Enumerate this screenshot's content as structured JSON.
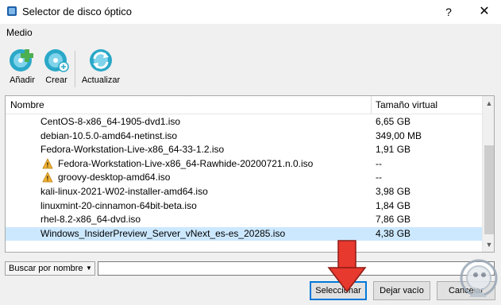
{
  "window": {
    "title": "Selector de disco óptico",
    "help_glyph": "?",
    "close_glyph": "✕"
  },
  "menu": {
    "medio": "Medio"
  },
  "toolbar": {
    "add_label": "Añadir",
    "create_label": "Crear",
    "refresh_label": "Actualizar"
  },
  "list": {
    "columns": {
      "name": "Nombre",
      "size": "Tamaño virtual"
    },
    "sort_glyph": "⌃",
    "rows": [
      {
        "name": "CentOS-8-x86_64-1905-dvd1.iso",
        "size": "6,65 GB",
        "warning": false,
        "selected": false
      },
      {
        "name": "debian-10.5.0-amd64-netinst.iso",
        "size": "349,00 MB",
        "warning": false,
        "selected": false
      },
      {
        "name": "Fedora-Workstation-Live-x86_64-33-1.2.iso",
        "size": "1,91 GB",
        "warning": false,
        "selected": false
      },
      {
        "name": "Fedora-Workstation-Live-x86_64-Rawhide-20200721.n.0.iso",
        "size": "--",
        "warning": true,
        "selected": false
      },
      {
        "name": "groovy-desktop-amd64.iso",
        "size": "--",
        "warning": true,
        "selected": false
      },
      {
        "name": "kali-linux-2021-W02-installer-amd64.iso",
        "size": "3,98 GB",
        "warning": false,
        "selected": false
      },
      {
        "name": "linuxmint-20-cinnamon-64bit-beta.iso",
        "size": "1,84 GB",
        "warning": false,
        "selected": false
      },
      {
        "name": "rhel-8.2-x86_64-dvd.iso",
        "size": "7,86 GB",
        "warning": false,
        "selected": false
      },
      {
        "name": "Windows_InsiderPreview_Server_vNext_es-es_20285.iso",
        "size": "4,38 GB",
        "warning": false,
        "selected": true
      }
    ]
  },
  "search": {
    "mode_label": "Buscar por nombre",
    "dropdown_glyph": "▼",
    "value": ""
  },
  "buttons": {
    "select": "Seleccionar",
    "empty": "Dejar vacío",
    "cancel": "Cancelar"
  },
  "colors": {
    "selection": "#cce8ff",
    "default_button_border": "#0078d7",
    "annotation_arrow": "#e8392f",
    "icon_teal": "#2aa8c8",
    "icon_green": "#4caf50"
  }
}
